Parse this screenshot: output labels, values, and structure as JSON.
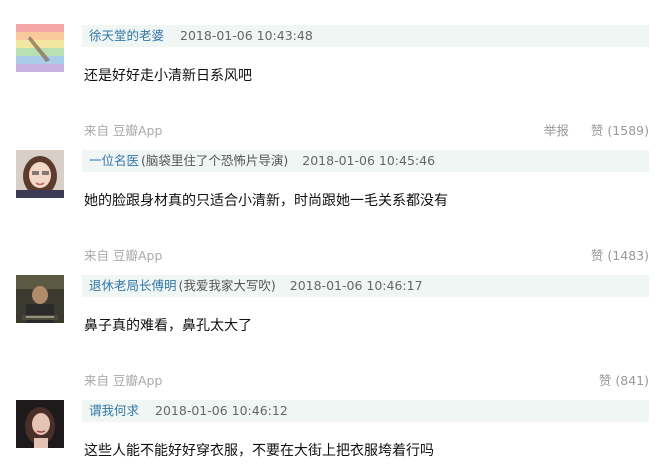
{
  "comments": [
    {
      "user": "徐天堂的老婆",
      "signature": "",
      "time": "2018-01-06 10:43:48",
      "content": "还是好好走小清新日系风吧",
      "source": "来自 豆瓣App",
      "report_label": "举报",
      "like_label": "赞",
      "like_count": "(1589)"
    },
    {
      "user": "一位名医",
      "signature": "(脑袋里住了个恐怖片导演)",
      "time": "2018-01-06 10:45:46",
      "content": "她的脸跟身材真的只适合小清新，时尚跟她一毛关系都没有",
      "source": "来自 豆瓣App",
      "like_label": "赞",
      "like_count": "(1483)"
    },
    {
      "user": "退休老局长傅明",
      "signature": "(我爱我家大写吹)",
      "time": "2018-01-06 10:46:17",
      "content": "鼻子真的难看，鼻孔太大了",
      "source": "来自 豆瓣App",
      "like_label": "赞",
      "like_count": "(841)"
    },
    {
      "user": "谓我何求",
      "signature": "",
      "time": "2018-01-06 10:46:12",
      "content": "这些人能不能好好穿衣服，不要在大街上把衣服垮着行吗"
    }
  ]
}
